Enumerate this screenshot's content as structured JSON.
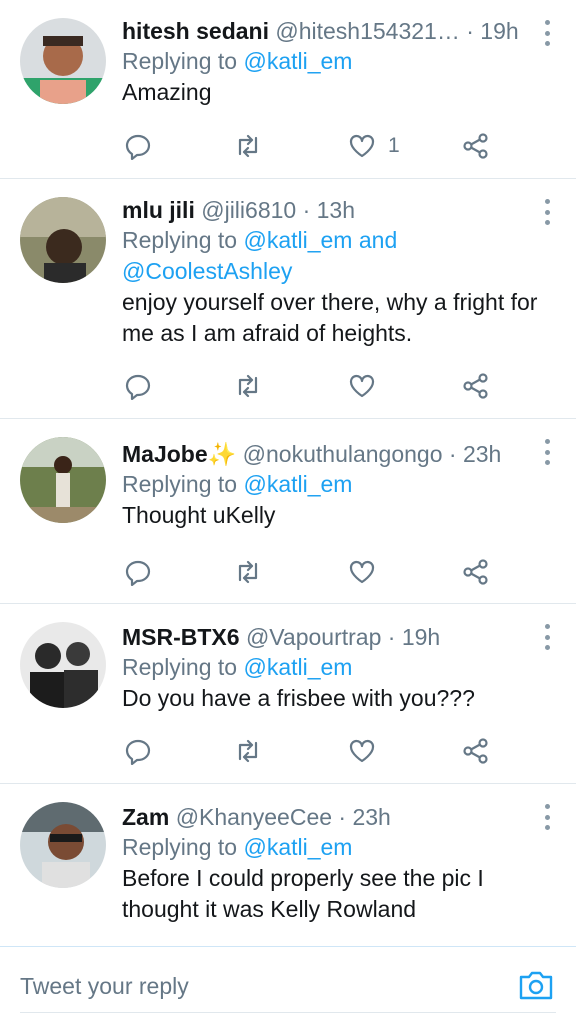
{
  "tweets": [
    {
      "display_name": "hitesh sedani",
      "handle": "@hitesh154321…",
      "time": "· 19h",
      "replying_label": "Replying to",
      "replying_to": "@katli_em",
      "replying_and": "",
      "replying_to_2": "",
      "text_lines": [
        "Amazing"
      ],
      "like_count": "1"
    },
    {
      "display_name": "mlu jili",
      "handle": "@jili6810",
      "time": "· 13h",
      "replying_label": "Replying to",
      "replying_to": "@katli_em",
      "replying_and": "and",
      "replying_to_2": "@CoolestAshley",
      "text_lines": [
        "enjoy yourself over there, why a fright for",
        "me as I am afraid of heights."
      ],
      "like_count": ""
    },
    {
      "display_name": "MaJobe✨",
      "handle": "@nokuthulangongo",
      "time": "· 23h",
      "replying_label": "Replying to",
      "replying_to": "@katli_em",
      "replying_and": "",
      "replying_to_2": "",
      "text_lines": [
        "Thought uKelly"
      ],
      "like_count": ""
    },
    {
      "display_name": "MSR-BTX6",
      "handle": "@Vapourtrap",
      "time": "· 19h",
      "replying_label": "Replying to",
      "replying_to": "@katli_em",
      "replying_and": "",
      "replying_to_2": "",
      "text_lines": [
        "Do you have a frisbee with you???"
      ],
      "like_count": ""
    },
    {
      "display_name": "Zam",
      "handle": "@KhanyeeCee",
      "time": "· 23h",
      "replying_label": "Replying to",
      "replying_to": "@katli_em",
      "replying_and": "",
      "replying_to_2": "",
      "text_lines": [
        "Before I could properly see the pic I",
        "thought it was Kelly Rowland"
      ],
      "like_count": ""
    }
  ],
  "reply_bar": {
    "placeholder": "Tweet your reply"
  },
  "icons": {
    "reply": "reply-icon",
    "retweet": "retweet-icon",
    "like": "heart-icon",
    "share": "share-icon",
    "more": "more-vertical-icon",
    "camera": "camera-icon"
  },
  "colors": {
    "accent": "#1da1f2",
    "secondary_text": "#657786",
    "divider": "#e1e8ed"
  }
}
